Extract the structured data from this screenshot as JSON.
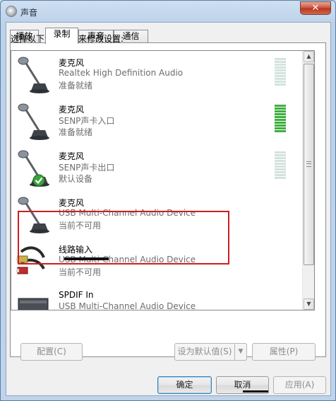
{
  "window": {
    "title": "声音",
    "close_glyph": "✕"
  },
  "tabs": [
    {
      "label": "播放"
    },
    {
      "label": "录制"
    },
    {
      "label": "声音"
    },
    {
      "label": "通信"
    }
  ],
  "panel": {
    "prompt": "选择以下录制设备来修改设置:"
  },
  "devices": [
    {
      "name": "麦克风",
      "description": "Realtek High Definition Audio",
      "status": "准备就绪",
      "level": 0,
      "default": false
    },
    {
      "name": "麦克风",
      "description": "SENP声卡入口",
      "status": "准备就绪",
      "level": 1.0,
      "default": false
    },
    {
      "name": "麦克风",
      "description": "SENP声卡出口",
      "status": "默认设备",
      "level": 0,
      "default": true
    },
    {
      "name": "麦克风",
      "description": "USB Multi-Channel Audio Device",
      "status": "当前不可用",
      "level": 0,
      "default": false
    },
    {
      "name": "线路输入",
      "description": "USB Multi-Channel Audio Device",
      "status": "当前不可用",
      "level": null,
      "default": false
    },
    {
      "name": "SPDIF In",
      "description": "USB Multi-Channel Audio Device",
      "status": "",
      "level": null,
      "default": false
    }
  ],
  "buttons": {
    "configure": "配置(C)",
    "set_default": "设为默认值(S)",
    "set_default_arrow": "▼",
    "properties": "属性(P)",
    "ok": "确定",
    "cancel": "取消",
    "apply": "应用(A)"
  },
  "scrollbar": {
    "up": "▲",
    "down": "▼"
  },
  "colors": {
    "highlight_box": "#cc1f1f",
    "meter_active": "#3fae3f",
    "meter_idle": "#d4e3de"
  }
}
